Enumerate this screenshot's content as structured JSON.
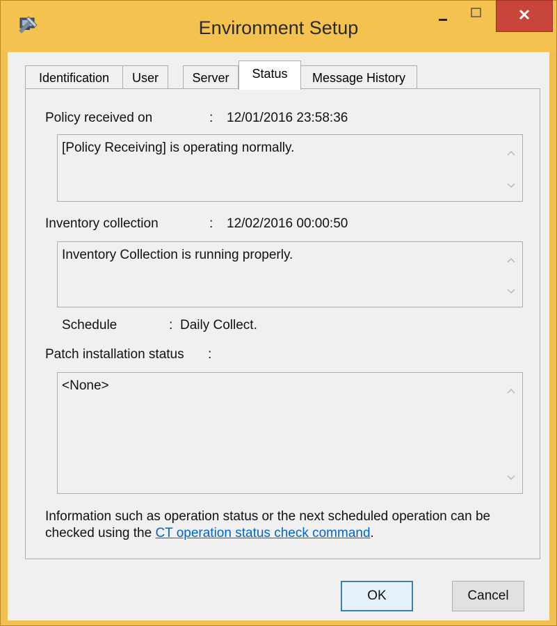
{
  "window": {
    "title": "Environment Setup"
  },
  "tabs": [
    {
      "label": "Identification"
    },
    {
      "label": "User"
    },
    {
      "label": "Server"
    },
    {
      "label": "Status"
    },
    {
      "label": "Message History"
    }
  ],
  "status": {
    "policy": {
      "label": "Policy received on",
      "separator": ":",
      "value": "12/01/2016 23:58:36",
      "message": "[Policy Receiving] is operating normally."
    },
    "inventory": {
      "label": "Inventory collection",
      "separator": ":",
      "value": "12/02/2016 00:00:50",
      "message": "Inventory Collection is running properly."
    },
    "schedule": {
      "label": "Schedule",
      "separator": ":",
      "value": "Daily Collect."
    },
    "patch": {
      "label": "Patch installation status",
      "separator": ":",
      "message": "<None>"
    },
    "info": {
      "text_before": "Information such as operation status or the next scheduled operation can be checked using the ",
      "link_text": "CT operation status check command",
      "text_after": "."
    }
  },
  "buttons": {
    "ok": "OK",
    "cancel": "Cancel"
  },
  "icons": {
    "app": "tools-computer-icon",
    "minimize": "minimize-icon",
    "maximize": "maximize-icon",
    "close": "close-icon",
    "scroll_up": "chevron-up-icon",
    "scroll_down": "chevron-down-icon"
  }
}
